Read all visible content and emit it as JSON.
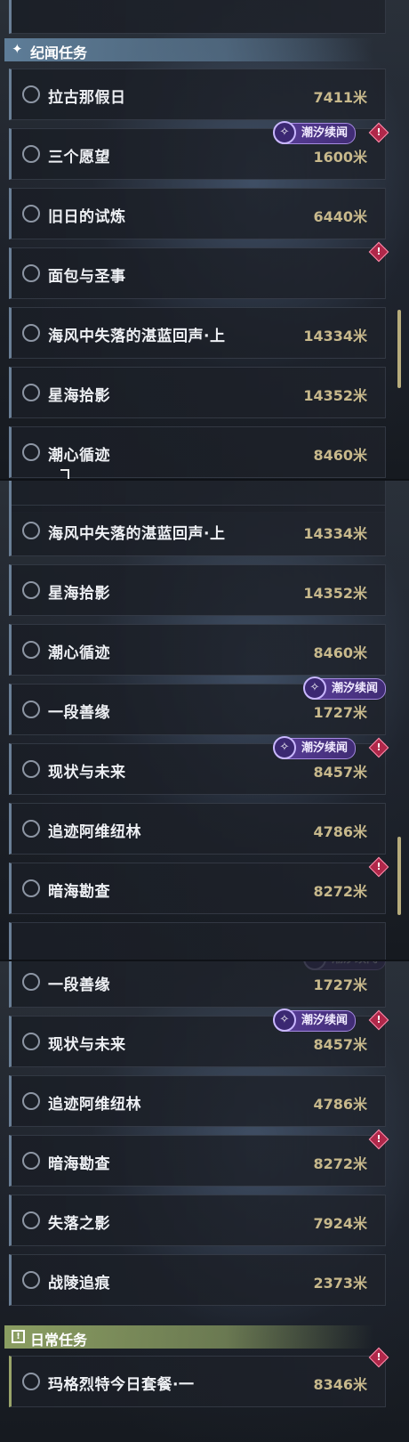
{
  "sections": {
    "story": {
      "icon": "sparkle-icon",
      "title": "纪闻任务"
    },
    "daily": {
      "icon": "exclamation-box-icon",
      "title": "日常任务"
    }
  },
  "tag_label": "潮汐续闻",
  "panel1": {
    "quests": [
      {
        "name": "拉古那假日",
        "dist": "7411米"
      },
      {
        "name": "三个愿望",
        "dist": "1600米"
      },
      {
        "name": "旧日的试炼",
        "dist": "6440米"
      },
      {
        "name": "面包与圣事",
        "dist": ""
      },
      {
        "name": "海风中失落的湛蓝回声·上",
        "dist": "14334米"
      },
      {
        "name": "星海拾影",
        "dist": "14352米"
      },
      {
        "name": "潮心循迹",
        "dist": "8460米"
      }
    ]
  },
  "panel2": {
    "quests": [
      {
        "name": "海风中失落的湛蓝回声·上",
        "dist": "14334米"
      },
      {
        "name": "星海拾影",
        "dist": "14352米"
      },
      {
        "name": "潮心循迹",
        "dist": "8460米"
      },
      {
        "name": "一段善缘",
        "dist": "1727米"
      },
      {
        "name": "现状与未来",
        "dist": "8457米"
      },
      {
        "name": "追迹阿维纽林",
        "dist": "4786米"
      },
      {
        "name": "暗海勘查",
        "dist": "8272米"
      }
    ]
  },
  "panel3": {
    "quests": [
      {
        "name": "一段善缘",
        "dist": "1727米"
      },
      {
        "name": "现状与未来",
        "dist": "8457米"
      },
      {
        "name": "追迹阿维纽林",
        "dist": "4786米"
      },
      {
        "name": "暗海勘查",
        "dist": "8272米"
      },
      {
        "name": "失落之影",
        "dist": "7924米"
      },
      {
        "name": "战陵追痕",
        "dist": "2373米"
      }
    ],
    "daily_quests": [
      {
        "name": "玛格烈特今日套餐·一",
        "dist": "8346米"
      }
    ]
  },
  "colors": {
    "accent_story": "#5e7d98",
    "accent_daily": "#8b9e62",
    "distance": "#c8b98c",
    "tag_purple": "#5a3e9a",
    "alert": "#b0284a"
  }
}
